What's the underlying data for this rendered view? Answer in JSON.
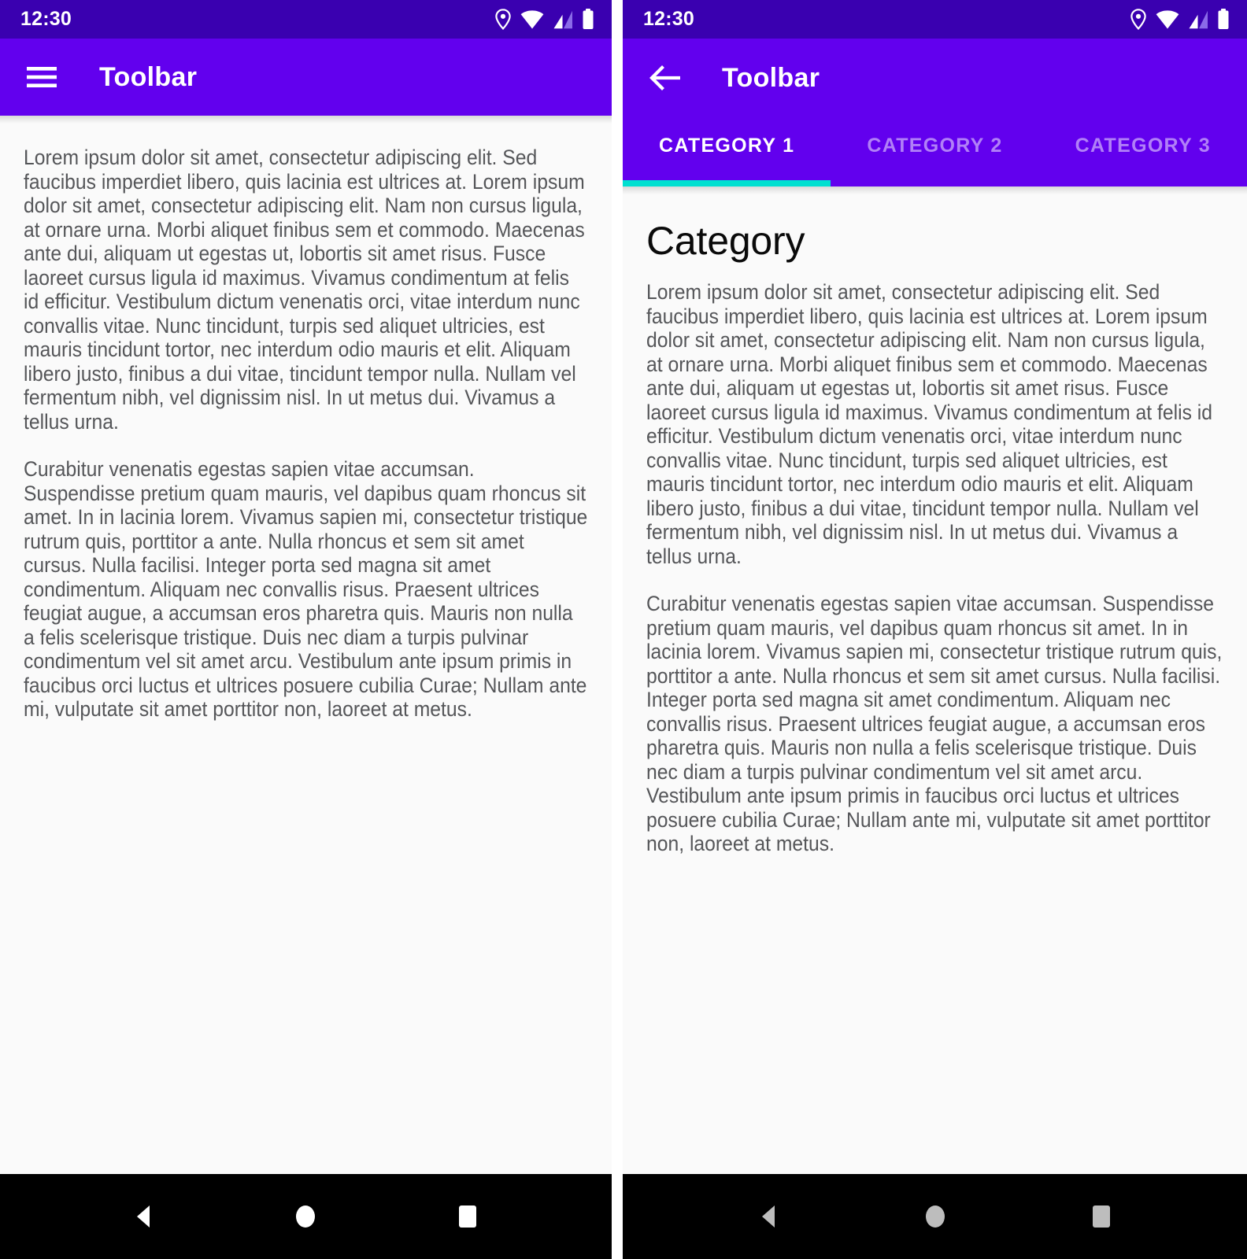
{
  "colors": {
    "statusbar": "#3A00B0",
    "toolbar": "#6200EE",
    "tab_indicator": "#00E0D0",
    "content_bg": "#FAFAFA",
    "body_text": "#555659",
    "navbar_bg": "#000000",
    "navbar_icon_left": "#FFFFFF",
    "navbar_icon_right": "#BDBDBD"
  },
  "body_text": {
    "paragraph1": "Lorem ipsum dolor sit amet, consectetur adipiscing elit. Sed faucibus imperdiet libero, quis lacinia est ultrices at. Lorem ipsum dolor sit amet, consectetur adipiscing elit. Nam non cursus ligula, at ornare urna. Morbi aliquet finibus sem et commodo. Maecenas ante dui, aliquam ut egestas ut, lobortis sit amet risus. Fusce laoreet cursus ligula id maximus. Vivamus condimentum at felis id efficitur. Vestibulum dictum venenatis orci, vitae interdum nunc convallis vitae. Nunc tincidunt, turpis sed aliquet ultricies, est mauris tincidunt tortor, nec interdum odio mauris et elit. Aliquam libero justo, finibus a dui vitae, tincidunt tempor nulla. Nullam vel fermentum nibh, vel dignissim nisl. In ut metus dui. Vivamus a tellus urna.",
    "paragraph2": "Curabitur venenatis egestas sapien vitae accumsan. Suspendisse pretium quam mauris, vel dapibus quam rhoncus sit amet. In in lacinia lorem. Vivamus sapien mi, consectetur tristique rutrum quis, porttitor a ante. Nulla rhoncus et sem sit amet cursus. Nulla facilisi. Integer porta sed magna sit amet condimentum. Aliquam nec convallis risus. Praesent ultrices feugiat augue, a accumsan eros pharetra quis. Mauris non nulla a felis scelerisque tristique. Duis nec diam a turpis pulvinar condimentum vel sit amet arcu. Vestibulum ante ipsum primis in faucibus orci luctus et ultrices posuere cubilia Curae; Nullam ante mi, vulputate sit amet porttitor non, laoreet at metus."
  },
  "left_phone": {
    "statusbar": {
      "time": "12:30",
      "icons": [
        "location-pin-icon",
        "wifi-icon",
        "cell-signal-icon",
        "battery-icon"
      ]
    },
    "toolbar": {
      "nav_icon": "hamburger-menu-icon",
      "title": "Toolbar"
    },
    "navbar": {
      "back_label": "Back",
      "home_label": "Home",
      "recents_label": "Recent apps"
    }
  },
  "right_phone": {
    "statusbar": {
      "time": "12:30",
      "icons": [
        "location-pin-icon",
        "wifi-icon",
        "cell-signal-icon",
        "battery-icon"
      ]
    },
    "toolbar": {
      "nav_icon": "back-arrow-icon",
      "title": "Toolbar"
    },
    "tabs": [
      {
        "label": "CATEGORY 1",
        "active": true
      },
      {
        "label": "CATEGORY 2",
        "active": false
      },
      {
        "label": "CATEGORY 3",
        "active": false
      }
    ],
    "content": {
      "heading": "Category"
    },
    "navbar": {
      "back_label": "Back",
      "home_label": "Home",
      "recents_label": "Recent apps"
    }
  }
}
